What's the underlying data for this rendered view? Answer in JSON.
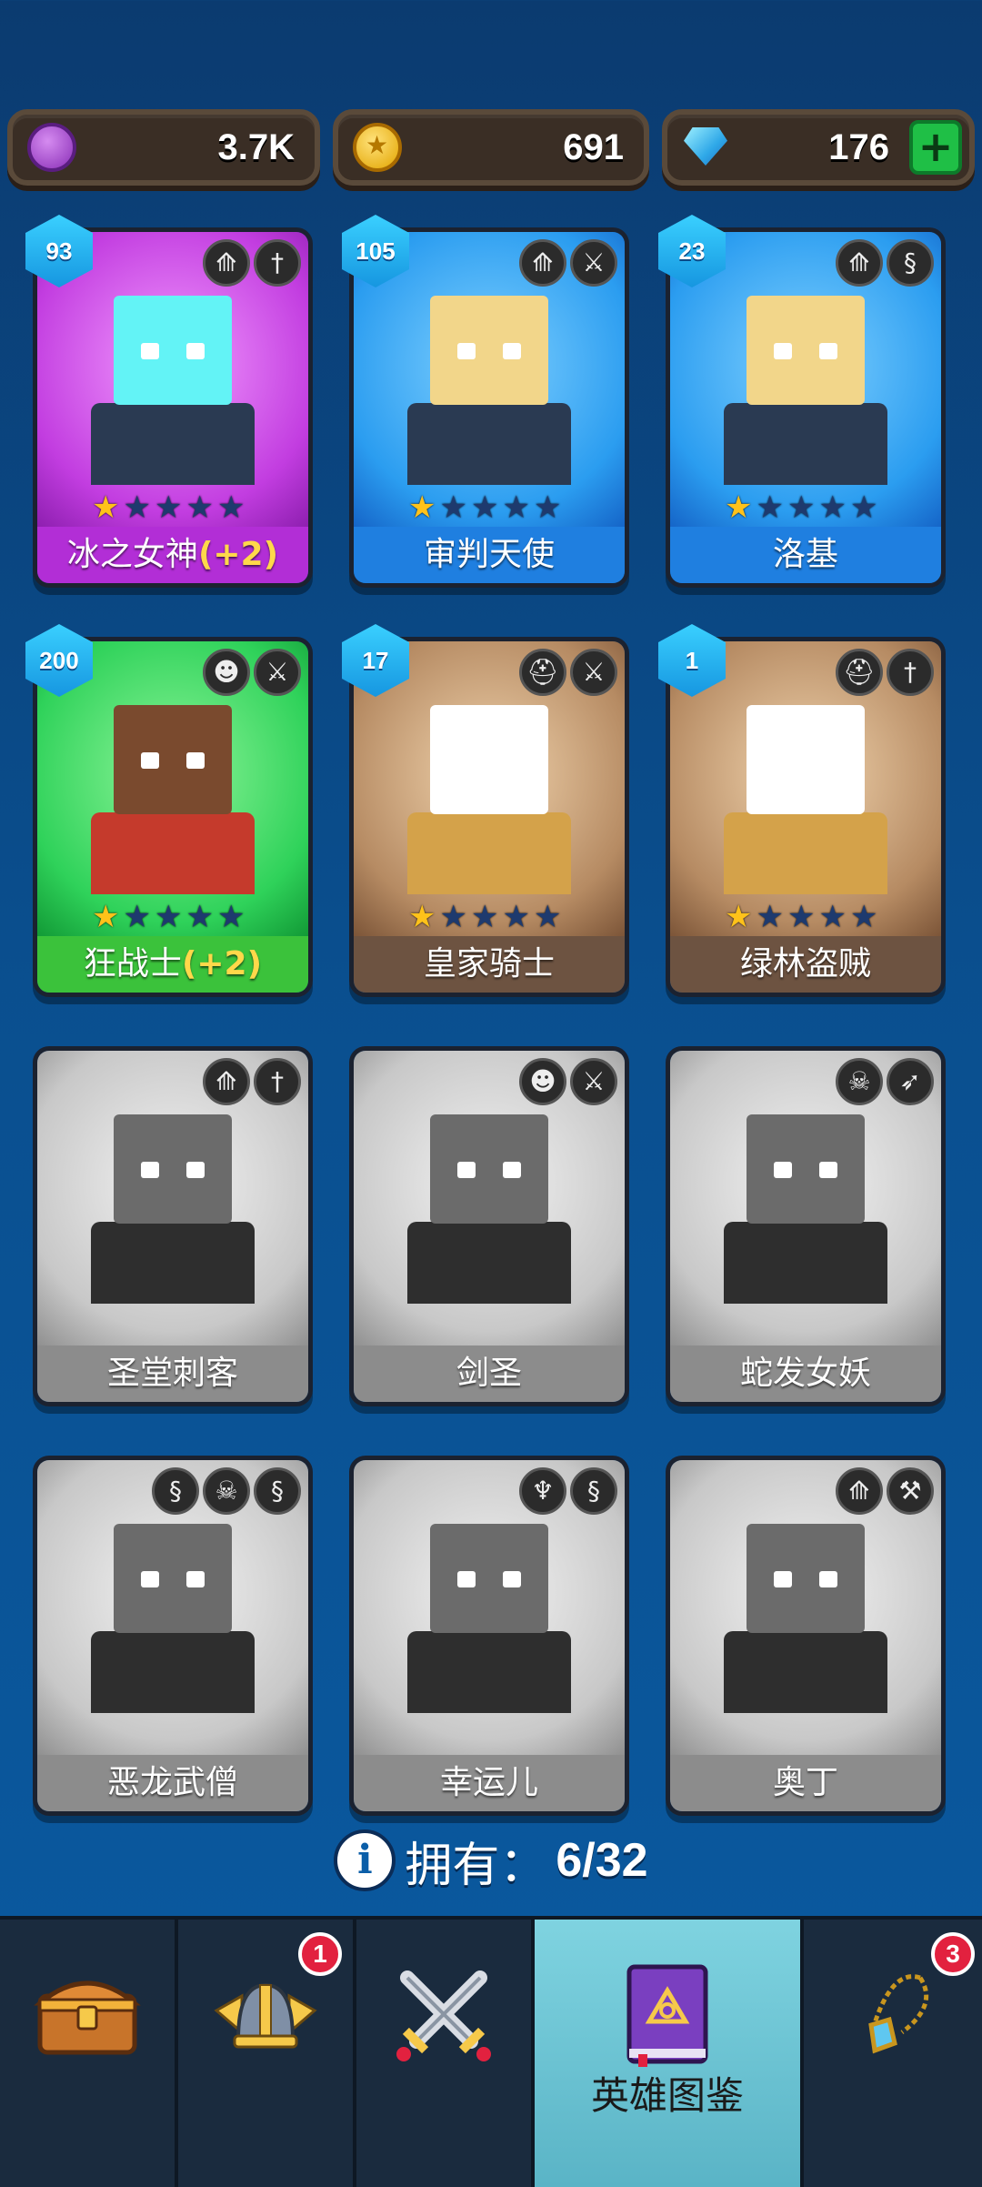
{
  "currency": {
    "purple_coins": "3.7K",
    "gold_coins": "691",
    "diamonds": "176"
  },
  "heroes": [
    {
      "name": "冰之女神",
      "bonus": "(+2)",
      "level": "93",
      "stars": 1,
      "theme": "purple",
      "traits": [
        "wings-icon",
        "dagger-icon"
      ]
    },
    {
      "name": "审判天使",
      "bonus": "",
      "level": "105",
      "stars": 1,
      "theme": "blue",
      "traits": [
        "wings-icon",
        "sword-icon"
      ]
    },
    {
      "name": "洛基",
      "bonus": "",
      "level": "23",
      "stars": 1,
      "theme": "blue",
      "traits": [
        "wings-icon",
        "dragon-icon"
      ]
    },
    {
      "name": "狂战士",
      "bonus": "(+2)",
      "level": "200",
      "stars": 1,
      "theme": "green",
      "traits": [
        "orc-icon",
        "sword-icon"
      ]
    },
    {
      "name": "皇家骑士",
      "bonus": "",
      "level": "17",
      "stars": 1,
      "theme": "brown",
      "traits": [
        "helmet-icon",
        "sword-icon"
      ]
    },
    {
      "name": "绿林盗贼",
      "bonus": "",
      "level": "1",
      "stars": 1,
      "theme": "brown",
      "traits": [
        "helmet-icon",
        "dagger-icon"
      ]
    },
    {
      "name": "圣堂刺客",
      "bonus": "",
      "level": "",
      "stars": 0,
      "theme": "gray",
      "traits": [
        "wings-icon",
        "dagger-icon"
      ]
    },
    {
      "name": "剑圣",
      "bonus": "",
      "level": "",
      "stars": 0,
      "theme": "gray",
      "traits": [
        "orc-icon",
        "sword-icon"
      ]
    },
    {
      "name": "蛇发女妖",
      "bonus": "",
      "level": "",
      "stars": 0,
      "theme": "gray",
      "traits": [
        "skull-icon",
        "bow-icon"
      ]
    },
    {
      "name": "恶龙武僧",
      "bonus": "",
      "level": "",
      "stars": 0,
      "theme": "gray",
      "traits": [
        "dragon-icon",
        "skull-icon",
        "dragon-icon"
      ]
    },
    {
      "name": "幸运儿",
      "bonus": "",
      "level": "",
      "stars": 0,
      "theme": "gray",
      "traits": [
        "elf-icon",
        "dragon-icon"
      ]
    },
    {
      "name": "奥丁",
      "bonus": "",
      "level": "",
      "stars": 0,
      "theme": "gray",
      "traits": [
        "wings-icon",
        "hammer-icon"
      ]
    }
  ],
  "owned": {
    "label": "拥有：",
    "count": "6/32"
  },
  "nav": {
    "items": [
      {
        "name": "chest",
        "label": ""
      },
      {
        "name": "helmet",
        "label": "",
        "badge": "1"
      },
      {
        "name": "battle",
        "label": ""
      },
      {
        "name": "hero-guide",
        "label": "英雄图鉴"
      },
      {
        "name": "amulet",
        "label": "",
        "badge": "3"
      }
    ]
  }
}
